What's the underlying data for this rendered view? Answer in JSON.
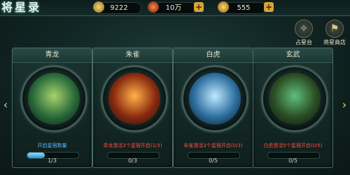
{
  "title": "将星录",
  "resources": [
    {
      "name": "gold",
      "value": "9222",
      "icon": "coin-icon",
      "color": "#c9a94a",
      "plus": false
    },
    {
      "name": "jade",
      "value": "10万",
      "icon": "jade-icon",
      "color": "#d25a2d",
      "plus": true
    },
    {
      "name": "ingot",
      "value": "555",
      "icon": "ingot-icon",
      "color": "#e6b33c",
      "plus": true
    }
  ],
  "side_buttons": [
    {
      "label": "占星台",
      "icon": "astrolabe-icon"
    },
    {
      "label": "将星商店",
      "icon": "shop-icon"
    }
  ],
  "cards": [
    {
      "name": "青龙",
      "beast": "dragon-icon",
      "caption": "开启星宿数量",
      "caption_color": "#5fb6ff",
      "count": "1/3",
      "progress": 0.34,
      "colors": [
        "#a7d36a",
        "#2a6a3a"
      ]
    },
    {
      "name": "朱雀",
      "beast": "phoenix-icon",
      "caption": "青龙激活3个星宿开启(1/3)",
      "caption_color": "#ff4b3a",
      "count": "0/3",
      "progress": 0,
      "colors": [
        "#ffb347",
        "#8a2a10"
      ]
    },
    {
      "name": "白虎",
      "beast": "tiger-icon",
      "caption": "朱雀激活3个星宿开启(0/3)",
      "caption_color": "#ff4b3a",
      "count": "0/5",
      "progress": 0,
      "colors": [
        "#bfe9ff",
        "#2d6fa0"
      ]
    },
    {
      "name": "玄武",
      "beast": "tortoise-icon",
      "caption": "白虎激活5个星宿开启(0/5)",
      "caption_color": "#ff4b3a",
      "count": "0/5",
      "progress": 0,
      "colors": [
        "#5fc07a",
        "#2b4d24"
      ]
    }
  ],
  "arrows": {
    "left": "‹",
    "right": "›"
  }
}
